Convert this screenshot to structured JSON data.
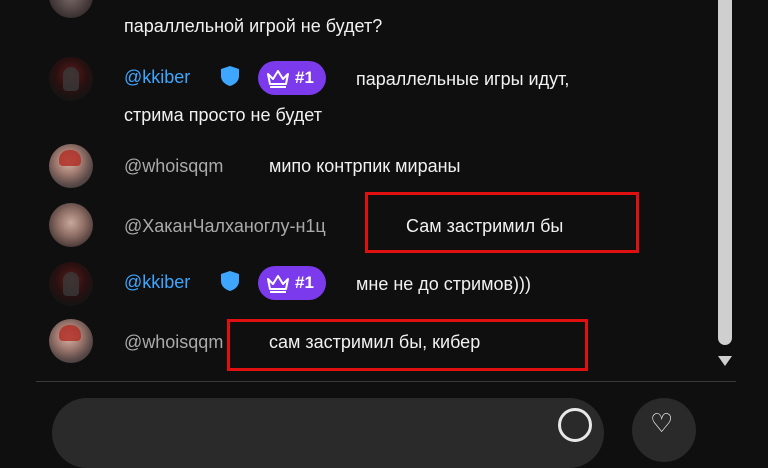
{
  "chat": {
    "messages": [
      {
        "username": "",
        "text": "параллельной игрой не будет?"
      },
      {
        "username": "@kkiber",
        "verified": true,
        "badge": "#1",
        "text_line1": "параллельные игры идут,",
        "text_line2": "стрима просто не будет"
      },
      {
        "username": "@whoisqqm",
        "text": "мипо контрпик мираны"
      },
      {
        "username": "@ХаканЧалханоглу-н1ц",
        "text": "Сам застримил бы"
      },
      {
        "username": "@kkiber",
        "verified": true,
        "badge": "#1",
        "text": "мне не до стримов)))"
      },
      {
        "username": "@whoisqqm",
        "text": "сам застримил бы, кибер"
      }
    ]
  },
  "icons": {
    "verified": "verified-shield-icon",
    "crown": "crown-icon",
    "scroll_down": "scroll-down-arrow-icon",
    "emoji": "emoji-icon",
    "heart": "heart-icon"
  },
  "colors": {
    "background": "#0f0f0f",
    "username_blue": "#3ea6ff",
    "badge_purple": "#7c3aed",
    "highlight_red": "#e01010"
  }
}
